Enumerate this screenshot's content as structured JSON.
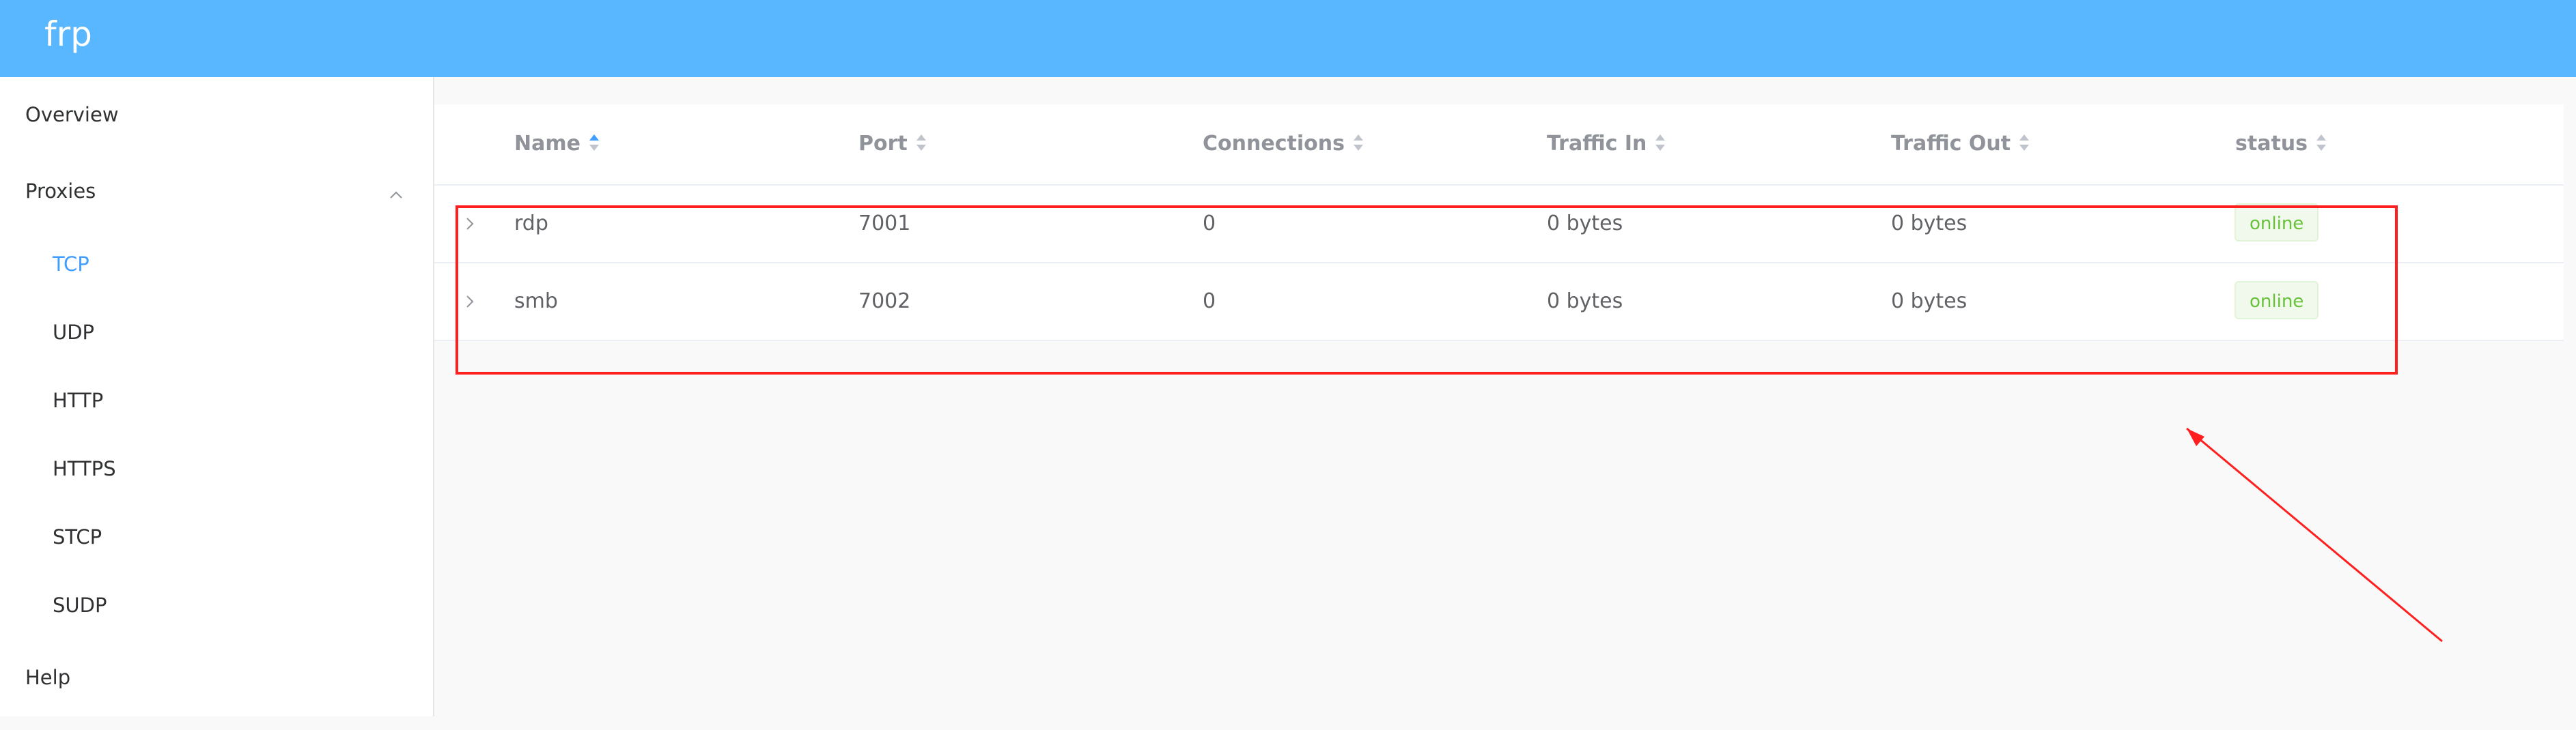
{
  "app": {
    "brand": "frp"
  },
  "sidebar": {
    "overview": "Overview",
    "proxies": "Proxies",
    "sub_items": [
      "TCP",
      "UDP",
      "HTTP",
      "HTTPS",
      "STCP",
      "SUDP"
    ],
    "active_item": "TCP",
    "help": "Help"
  },
  "table": {
    "columns": [
      "Name",
      "Port",
      "Connections",
      "Traffic In",
      "Traffic Out",
      "status"
    ],
    "sorted_column": "Name",
    "rows": [
      {
        "name": "rdp",
        "port": "7001",
        "connections": "0",
        "traffic_in": "0 bytes",
        "traffic_out": "0 bytes",
        "status": "online"
      },
      {
        "name": "smb",
        "port": "7002",
        "connections": "0",
        "traffic_in": "0 bytes",
        "traffic_out": "0 bytes",
        "status": "online"
      }
    ]
  },
  "colors": {
    "header": "#58b7ff",
    "active": "#409eff",
    "status_online": "#67c23a",
    "annotation": "#ff1f1f"
  }
}
